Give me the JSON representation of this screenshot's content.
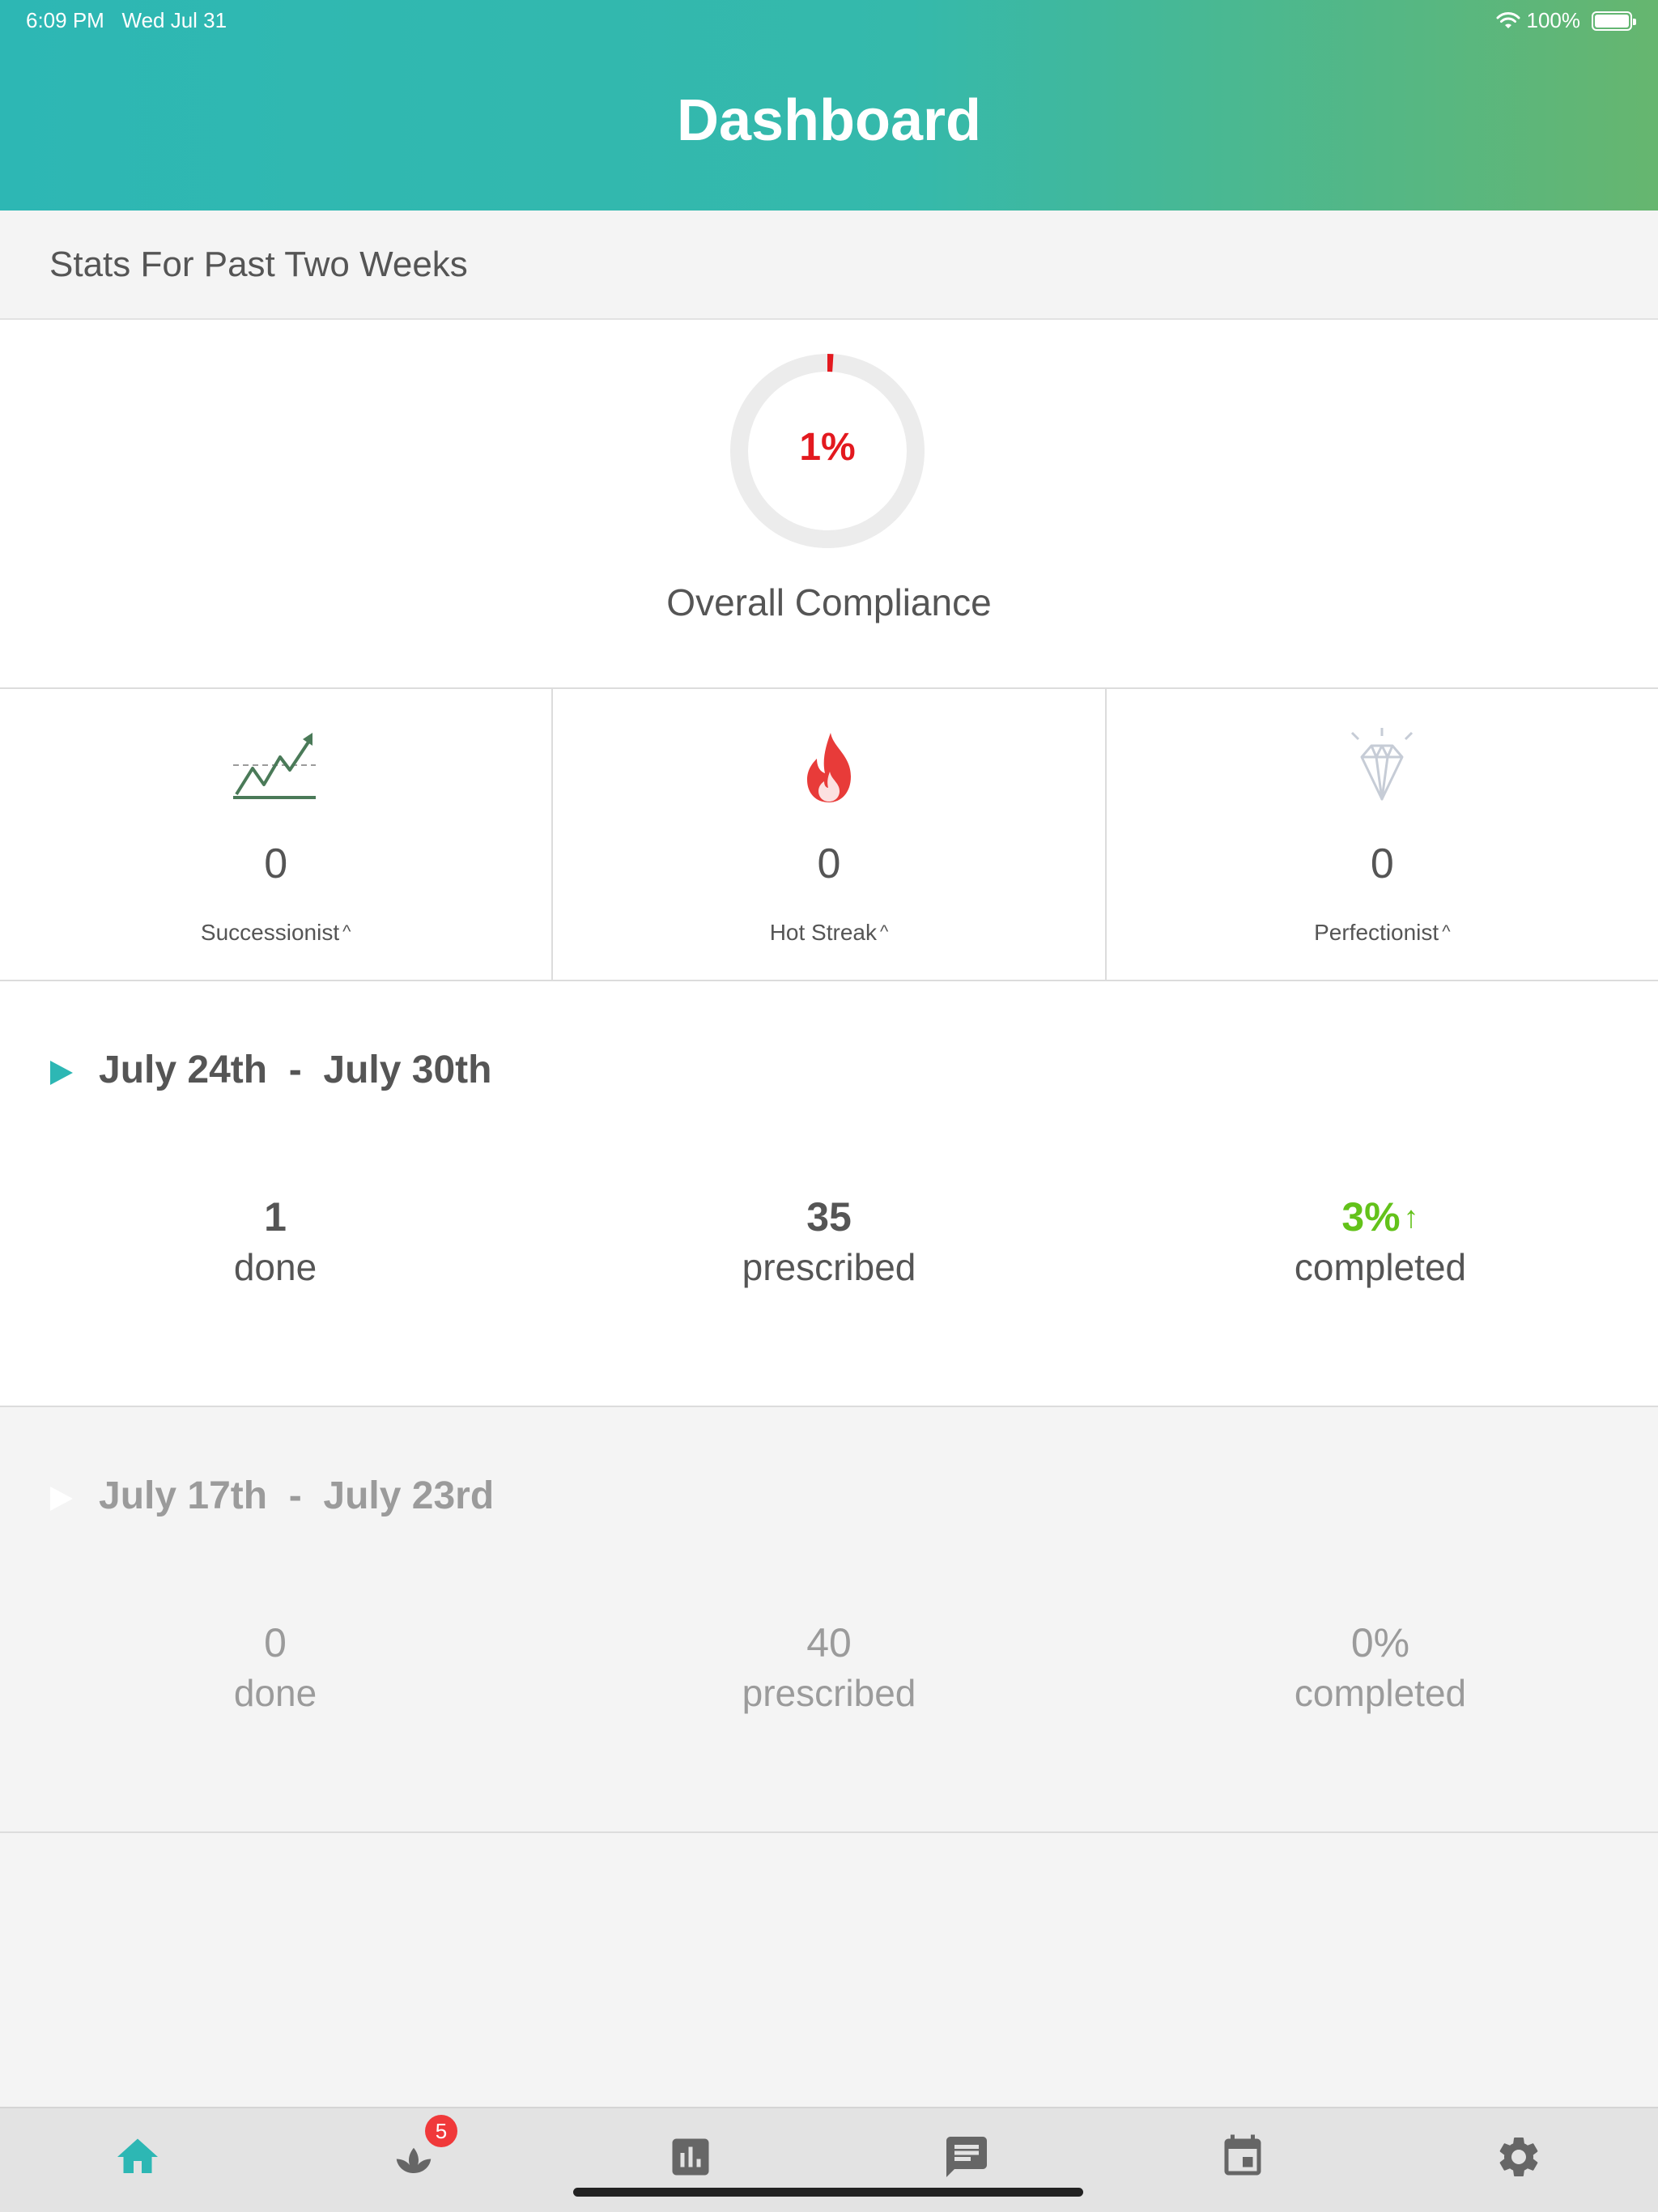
{
  "status_bar": {
    "time": "6:09 PM",
    "date": "Wed Jul 31",
    "battery": "100%"
  },
  "header": {
    "title": "Dashboard"
  },
  "section_title": "Stats For Past Two Weeks",
  "compliance": {
    "percent_label": "1%",
    "value_fraction": 0.01,
    "title": "Overall Compliance",
    "accent": "#e3191f",
    "track": "#ececec"
  },
  "badges": [
    {
      "icon": "trend-chart-icon",
      "count": "0",
      "label": "Successionist"
    },
    {
      "icon": "flame-icon",
      "count": "0",
      "label": "Hot Streak"
    },
    {
      "icon": "diamond-icon",
      "count": "0",
      "label": "Perfectionist"
    }
  ],
  "weeks": [
    {
      "range": "July 24th  -  July 30th",
      "done": "1",
      "done_label": "done",
      "prescribed": "35",
      "prescribed_label": "prescribed",
      "completed": "3%",
      "completed_label": "completed",
      "trend": "up"
    },
    {
      "range": "July 17th  -  July 23rd",
      "done": "0",
      "done_label": "done",
      "prescribed": "40",
      "prescribed_label": "prescribed",
      "completed": "0%",
      "completed_label": "completed"
    }
  ],
  "tabbar": {
    "tabs": [
      {
        "icon": "home-icon",
        "active": true
      },
      {
        "icon": "lotus-icon",
        "badge": "5"
      },
      {
        "icon": "bar-chart-icon"
      },
      {
        "icon": "message-icon"
      },
      {
        "icon": "calendar-icon"
      },
      {
        "icon": "gear-icon"
      }
    ]
  },
  "colors": {
    "brand_teal": "#2db7b4",
    "brand_green": "#66b66f",
    "positive": "#63c21a",
    "badge_red": "#f0393a"
  }
}
